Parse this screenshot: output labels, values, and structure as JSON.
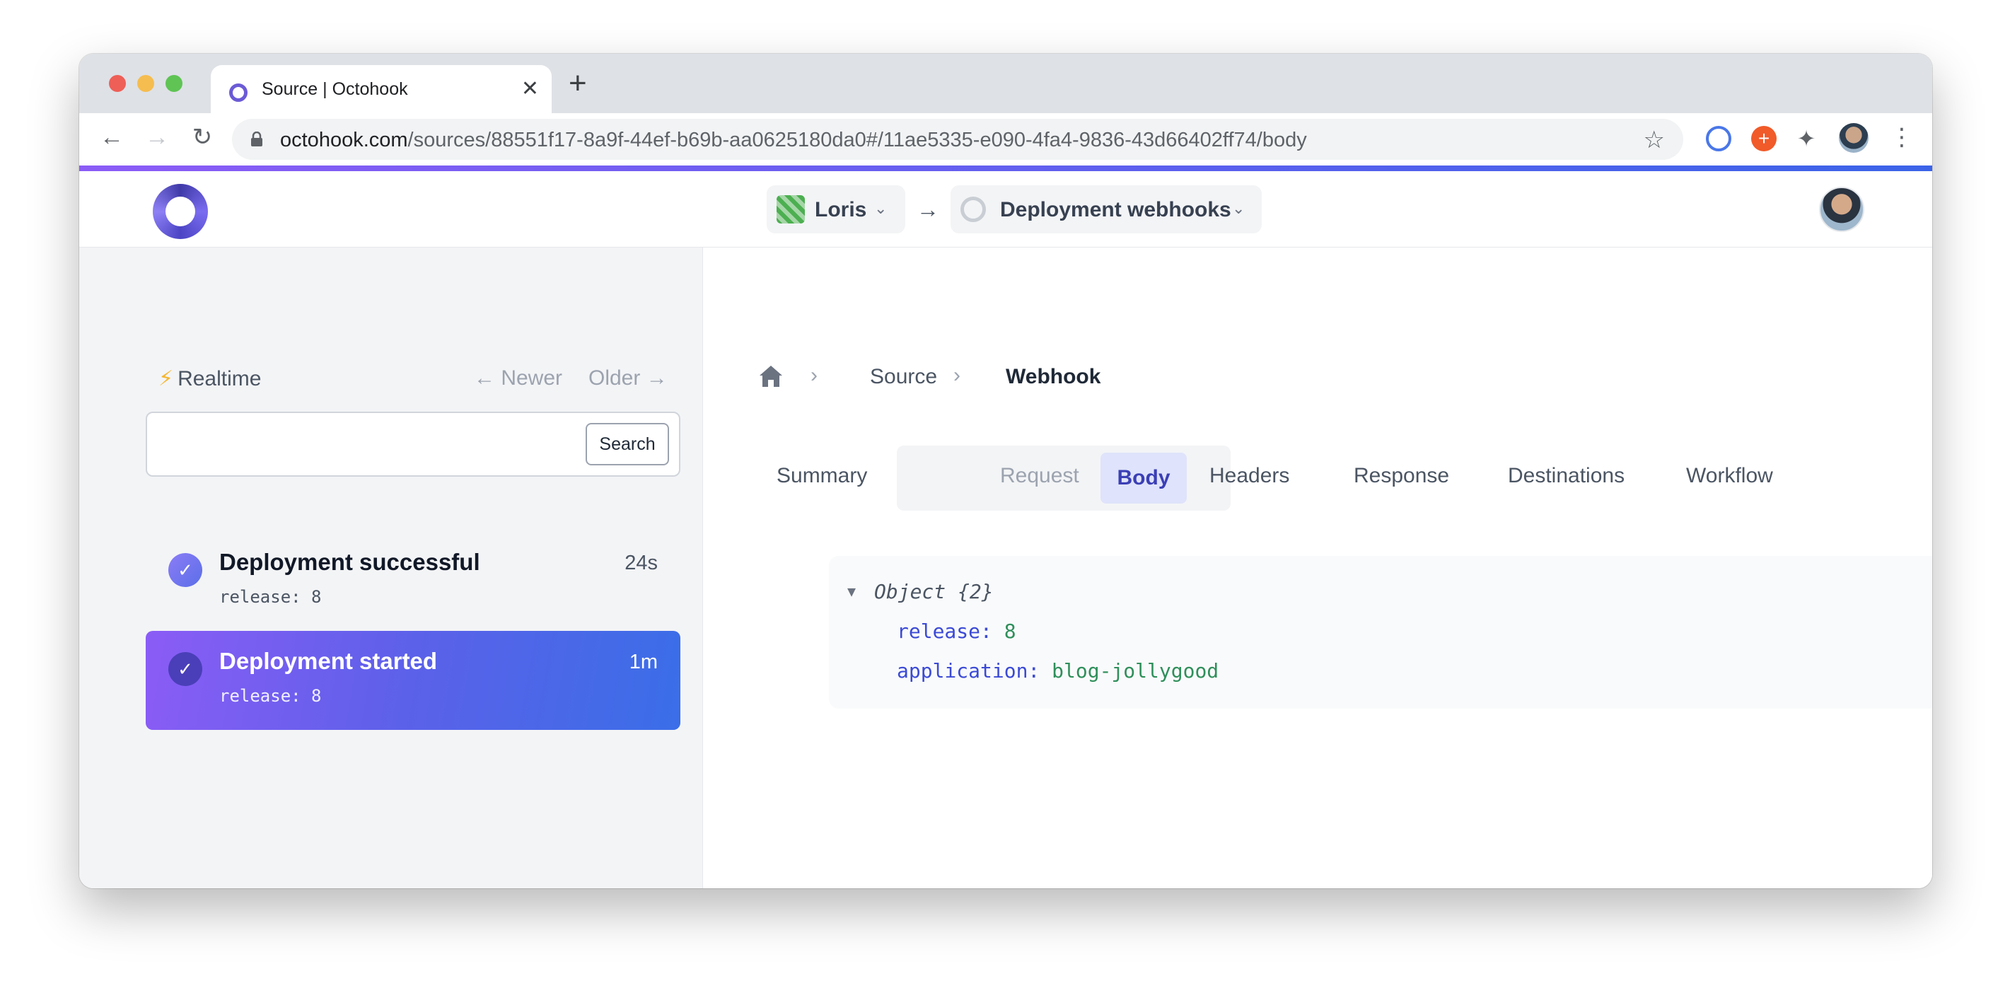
{
  "browser": {
    "tab_title": "Source | Octohook",
    "tab_close": "✕",
    "new_tab": "+",
    "url_host": "octohook.com",
    "url_path": "/sources/88551f17-8a9f-44ef-b69b-aa0625180da0#/11ae5335-e090-4fa4-9836-43d66402ff74/body",
    "icons": [
      "back-icon",
      "forward-icon",
      "reload-icon",
      "lock-icon",
      "star-icon",
      "extension-icon",
      "more-icon"
    ]
  },
  "header": {
    "org_label": "Loris",
    "source_label": "Deployment webhooks",
    "arrow": "→",
    "chevron": "⌄"
  },
  "sidebar": {
    "realtime_label": "Realtime",
    "newer_label": "← Newer",
    "older_label": "Older →",
    "search_value": "",
    "search_button": "Search",
    "events": [
      {
        "title": "Deployment successful",
        "time": "24s",
        "subtitle": "release: 8",
        "selected": false
      },
      {
        "title": "Deployment started",
        "time": "1m",
        "subtitle": "release: 8",
        "selected": true
      }
    ]
  },
  "main": {
    "breadcrumb": {
      "source": "Source",
      "webhook": "Webhook",
      "separator": "›"
    },
    "tabs": {
      "summary": "Summary",
      "request": "Request",
      "body": "Body",
      "headers": "Headers",
      "response": "Response",
      "destinations": "Destinations",
      "workflow": "Workflow"
    },
    "active_tab": "Body",
    "json": {
      "toggle": "▼",
      "object_label": "Object {2}",
      "entries": [
        {
          "key": "release:",
          "value": "8"
        },
        {
          "key": "application:",
          "value": "blog-jollygood"
        }
      ]
    }
  },
  "colors": {
    "accent_start": "#8b5cf6",
    "accent_end": "#3b63e8",
    "json_key": "#3b4ad6",
    "json_value": "#2f8f5b",
    "active_tab_bg": "#dfe3fb"
  }
}
